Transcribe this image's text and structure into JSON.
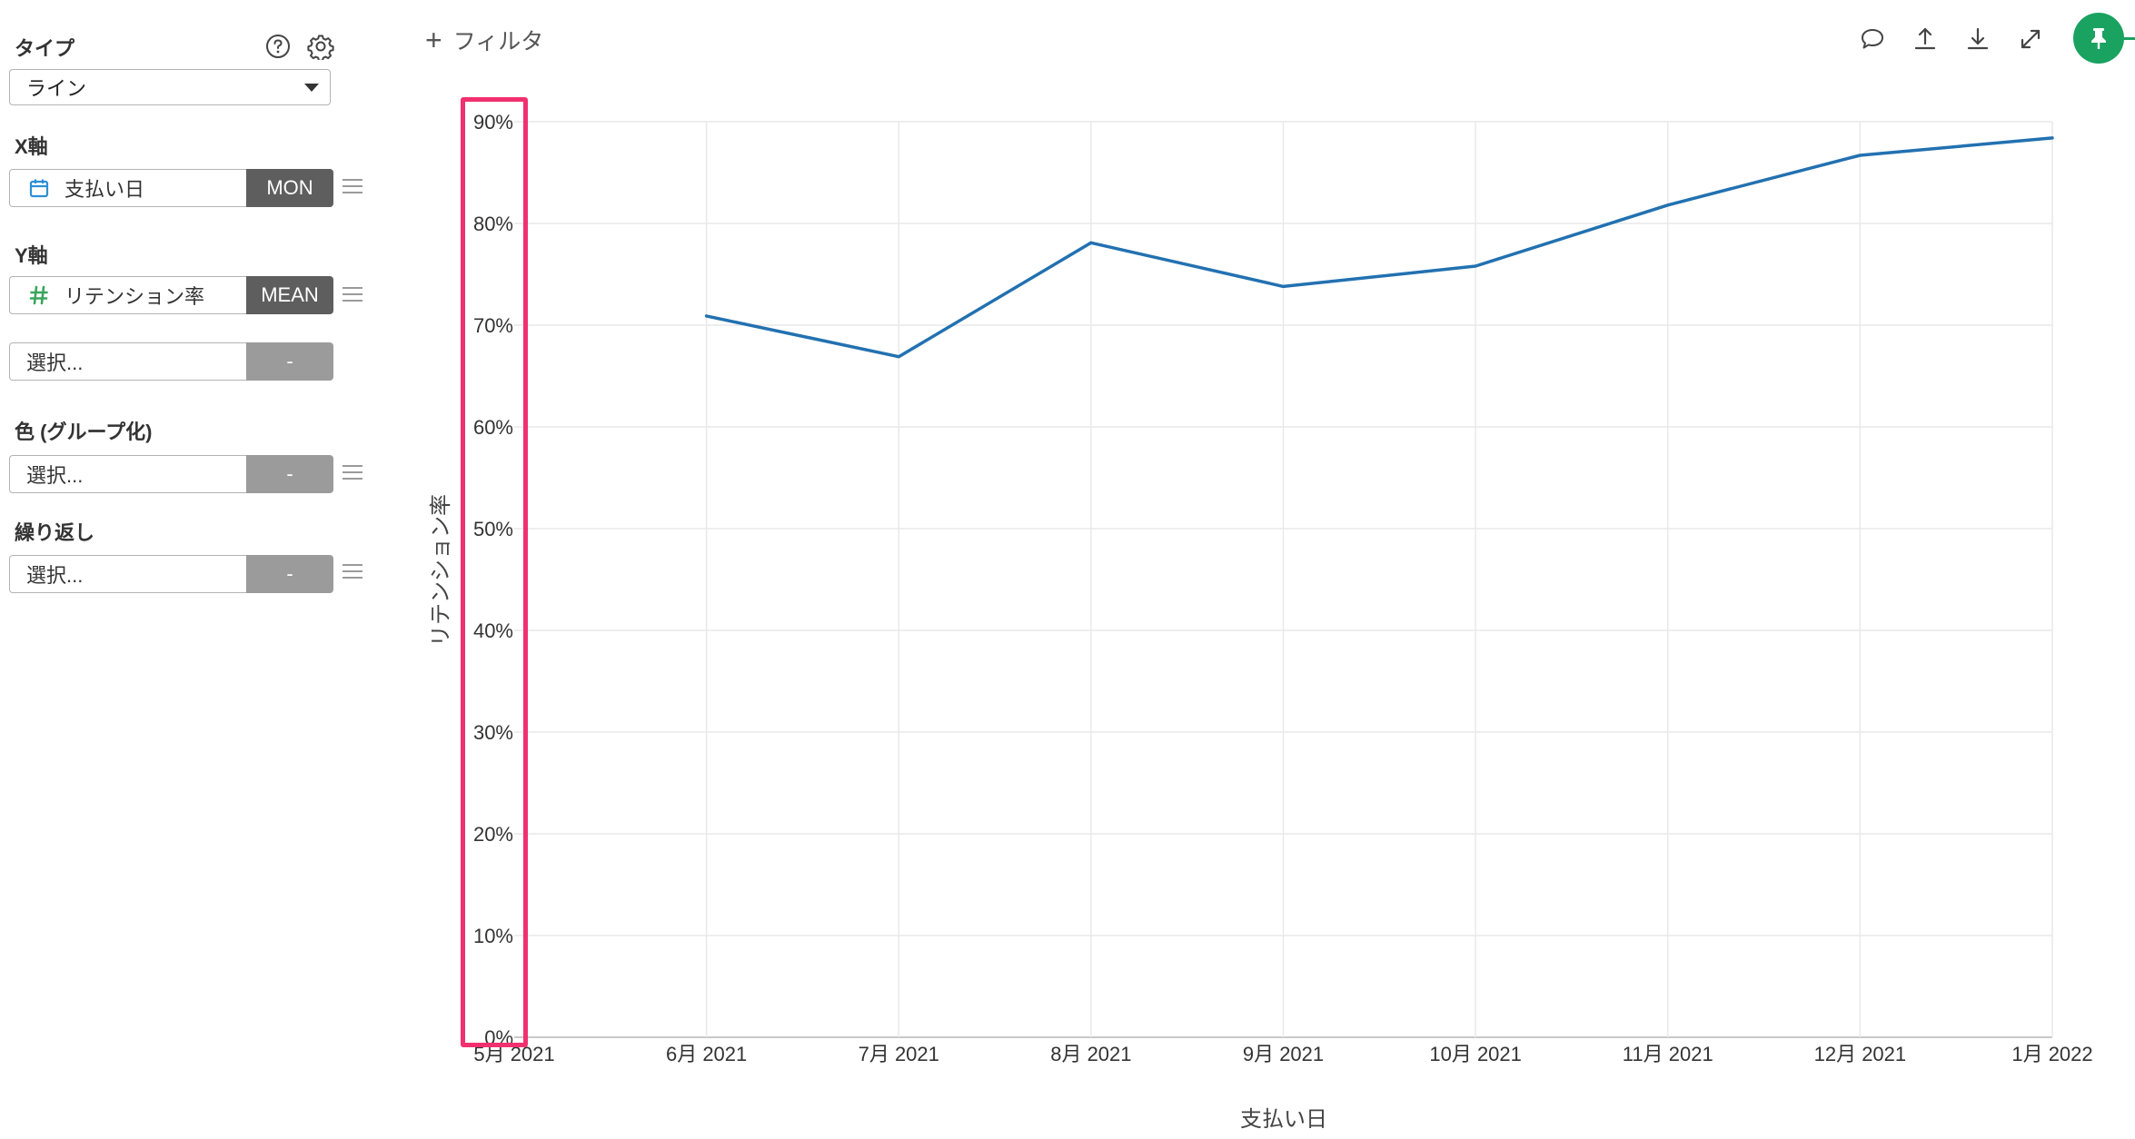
{
  "sidebar": {
    "type_label": "タイプ",
    "type_value": "ライン",
    "x_axis_label": "X軸",
    "x_field": {
      "name": "支払い日",
      "agg": "MON",
      "icon": "calendar-icon"
    },
    "y_axis_label": "Y軸",
    "y_field": {
      "name": "リテンション率",
      "agg": "MEAN",
      "icon": "hash-icon"
    },
    "y_field2": {
      "placeholder": "選択...",
      "agg": "-"
    },
    "color_label": "色 (グループ化)",
    "color_field": {
      "placeholder": "選択...",
      "agg": "-"
    },
    "repeat_label": "繰り返し",
    "repeat_field": {
      "placeholder": "選択...",
      "agg": "-"
    }
  },
  "toolbar": {
    "filter_label": "フィルタ",
    "icons": [
      "comment-icon",
      "upload-icon",
      "download-icon",
      "expand-icon",
      "pin-icon"
    ]
  },
  "colors": {
    "line": "#2271b1",
    "highlight": "#f0306f",
    "pin": "#1aa260",
    "x_icon": "#2d8fd5",
    "y_icon": "#3aa55d"
  },
  "chart_data": {
    "type": "line",
    "xlabel": "支払い日",
    "ylabel": "リテンション率",
    "x_ticks": [
      "5月 2021",
      "6月 2021",
      "7月 2021",
      "8月 2021",
      "9月 2021",
      "10月 2021",
      "11月 2021",
      "12月 2021",
      "1月 2022"
    ],
    "y_ticks": [
      "0%",
      "10%",
      "20%",
      "30%",
      "40%",
      "50%",
      "60%",
      "70%",
      "80%",
      "90%"
    ],
    "ylim": [
      0,
      90
    ],
    "grid": true,
    "series": [
      {
        "x": [
          "6月 2021",
          "7月 2021",
          "8月 2021",
          "9月 2021",
          "10月 2021",
          "11月 2021",
          "12月 2021",
          "1月 2022"
        ],
        "values": [
          70.9,
          66.9,
          78.1,
          73.8,
          75.8,
          81.8,
          86.7,
          88.4
        ]
      }
    ]
  }
}
